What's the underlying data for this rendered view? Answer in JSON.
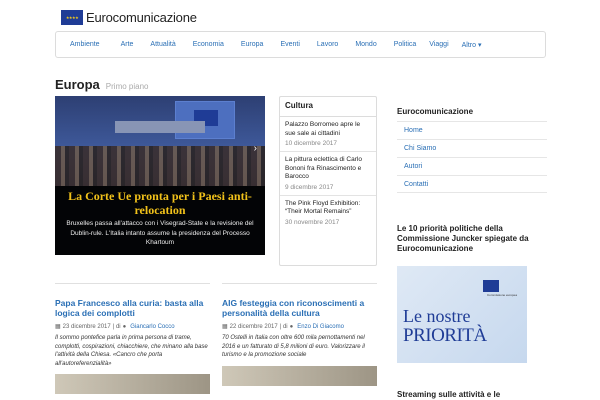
{
  "brand": {
    "name": "Eurocomunicazione"
  },
  "nav": {
    "items": [
      "Ambiente",
      "Arte",
      "Attualità",
      "Economia",
      "Europa",
      "Eventi",
      "Lavoro",
      "Mondo",
      "Politica",
      "Viaggi",
      "Altro ▾"
    ]
  },
  "section": {
    "title": "Europa",
    "subtitle": "Primo piano"
  },
  "hero": {
    "title": "La Corte Ue pronta per i Paesi anti-relocation",
    "desc": "Bruxelles passa all'attacco con i Visegrad-State e la revisione del Dublin-rule. L'Italia intanto assume la presidenza del Processo Khartoum"
  },
  "cultura": {
    "heading": "Cultura",
    "items": [
      {
        "title": "Palazzo Borromeo apre le sue sale ai cittadini",
        "date": "10 dicembre 2017"
      },
      {
        "title": "La pittura eclettica di Carlo Bononi fra Rinascimento e Barocco",
        "date": "9 dicembre 2017"
      },
      {
        "title": "The Pink Floyd Exhibition: “Their Mortal Remains”",
        "date": "30 novembre 2017"
      }
    ]
  },
  "sidebar": {
    "title": "Eurocomunicazione",
    "menu": [
      "Home",
      "Chi Siamo",
      "Autori",
      "Contatti"
    ],
    "priorities_title": "Le 10 priorità politiche della Commissione Juncker spiegate da Eurocomunicazione",
    "priorities_img_line1": "Le nostre",
    "priorities_img_line2": "PRIORITÀ",
    "priorities_img_caption": "Commissione europea",
    "stream_title": "Streaming sulle attività e le"
  },
  "articles": [
    {
      "title": "Papa Francesco alla curia: basta alla logica dei complotti",
      "date": "23 dicembre 2017",
      "by": "| di",
      "author": "Giancarlo Cocco",
      "excerpt": "Il sommo pontefice parla in prima persona di trame, complotti, cospirazioni, chiacchiere, che minano alla base l'attività della Chiesa. «Cancro che porta all'autoreferenzialità»"
    },
    {
      "title": "AIG festeggia con riconoscimenti a personalità della cultura",
      "date": "22 dicembre 2017",
      "by": "| di",
      "author": "Enzo Di Giacomo",
      "excerpt": "70 Ostelli in Italia con oltre 600 mila pernottamenti nel 2016 e un fatturato di 5,8 milioni di euro. Valorizzare il turismo e la promozione sociale"
    }
  ],
  "colors": {
    "link": "#2a6fb5",
    "accent": "#f2c21a",
    "flag": "#1f3c96"
  }
}
